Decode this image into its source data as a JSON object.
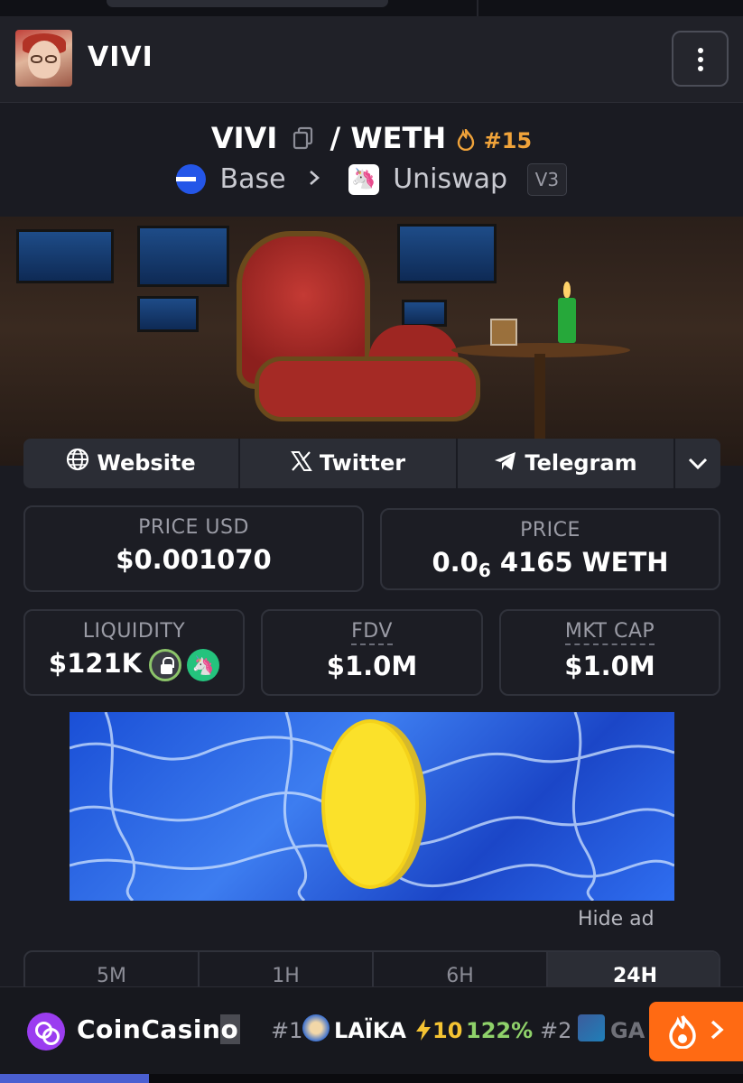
{
  "header": {
    "token_name": "VIVI"
  },
  "pair": {
    "base": "VIVI",
    "separator": "/",
    "quote": "WETH",
    "rank": "#15",
    "chain": "Base",
    "dex": "Uniswap",
    "version": "V3"
  },
  "links": {
    "website": "Website",
    "twitter": "Twitter",
    "telegram": "Telegram"
  },
  "stats": {
    "price_usd_label": "PRICE USD",
    "price_usd": "$0.001070",
    "price_label": "PRICE",
    "price_lead": "0.0",
    "price_zeros": "6",
    "price_tail": "4165 WETH",
    "liquidity_label": "LIQUIDITY",
    "liquidity": "$121K",
    "fdv_label": "FDV",
    "fdv": "$1.0M",
    "mktcap_label": "MKT CAP",
    "mktcap": "$1.0M"
  },
  "ad": {
    "hide_label": "Hide ad"
  },
  "timeframes": [
    "5M",
    "1H",
    "6H",
    "24H"
  ],
  "active_timeframe": "24H",
  "footer": {
    "casino_brand_main": "CoinCasin",
    "casino_brand_last": "o",
    "trending_1_rank": "#1",
    "trending_1_name": "LAÏKA",
    "trending_1_boost": "10",
    "trending_1_pct": "122%",
    "trending_2_rank": "#2",
    "trending_2_name": "GA"
  },
  "colors": {
    "background": "#1a1b22",
    "rank_orange": "#f0a33a",
    "base_blue": "#2456e8",
    "uniswap_pink": "#ff1f8e",
    "fire_orange": "#ff6a13",
    "positive_green": "#8fd16a"
  }
}
